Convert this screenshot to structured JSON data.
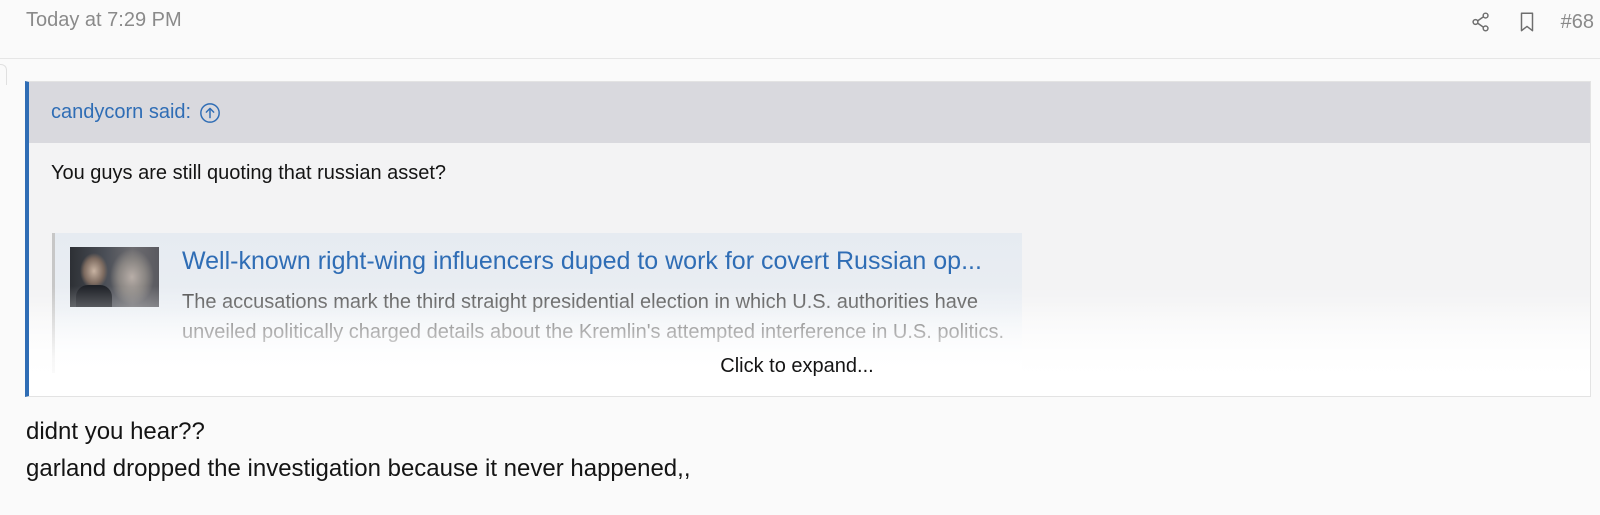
{
  "header": {
    "timestamp": "Today at 7:29 PM",
    "post_number": "#68",
    "icons": [
      "share-icon",
      "bookmark-icon"
    ]
  },
  "quote": {
    "author": "candycorn said:",
    "jump_icon": "arrow-up-circle-icon",
    "text": "You guys are still quoting that russian asset?",
    "embed": {
      "title": "Well-known right-wing influencers duped to work for covert Russian op...",
      "description": "The accusations mark the third straight presidential election in which U.S. authorities have unveiled politically charged details about the Kremlin's attempted interference in U.S. politics."
    },
    "expand_label": "Click to expand..."
  },
  "reply": {
    "line1": "didnt you hear??",
    "line2": "garland dropped the investigation because it never happened,,"
  },
  "colors": {
    "accent": "#2f6db5",
    "quote_header_bg": "#d9d9de",
    "muted_text": "#8a8a8a"
  }
}
